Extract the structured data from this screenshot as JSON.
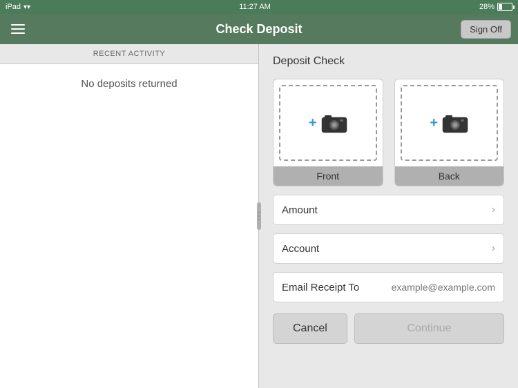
{
  "status_bar": {
    "device": "iPad",
    "wifi": "wifi",
    "time": "11:27 AM",
    "battery_percent": "28%"
  },
  "nav": {
    "title": "Check Deposit",
    "sign_off_label": "Sign Off",
    "hamburger_label": "Menu"
  },
  "left_panel": {
    "section_header": "RECENT ACTIVITY",
    "empty_message": "No deposits returned"
  },
  "right_panel": {
    "title": "Deposit Check",
    "front_label": "Front",
    "back_label": "Back",
    "amount_label": "Amount",
    "account_label": "Account",
    "email_label": "Email Receipt To",
    "email_placeholder": "example@example.com",
    "cancel_label": "Cancel",
    "continue_label": "Continue"
  }
}
